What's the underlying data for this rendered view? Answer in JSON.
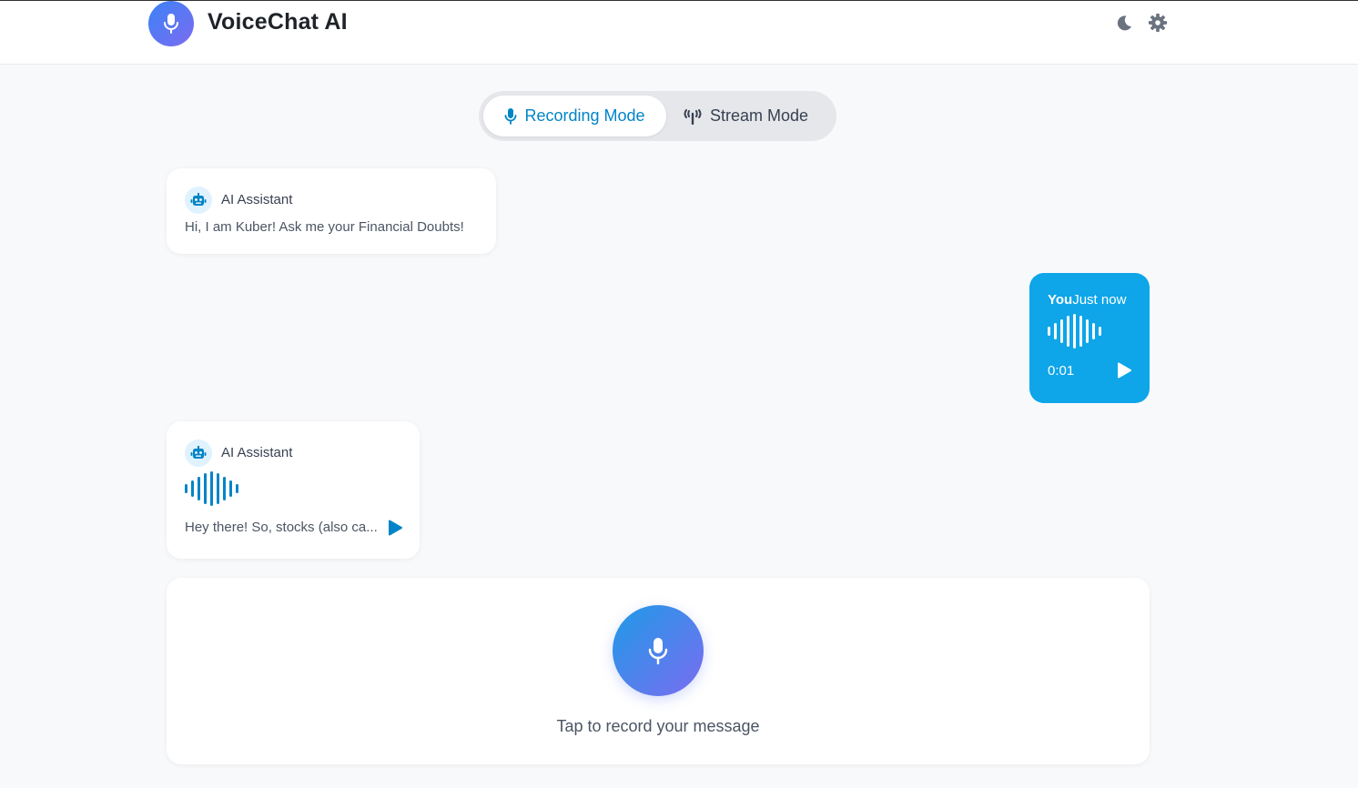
{
  "app": {
    "title": "VoiceChat AI"
  },
  "header": {
    "icons": [
      "moon-icon",
      "gear-icon"
    ]
  },
  "modes": {
    "recording_label": "Recording Mode",
    "stream_label": "Stream Mode",
    "active": "Recording Mode"
  },
  "messages": [
    {
      "sender": "AI Assistant",
      "text": "Hi, I am Kuber! Ask me your Financial Doubts!"
    },
    {
      "sender": "You",
      "time": "Just now",
      "duration": "0:01"
    },
    {
      "sender": "AI Assistant",
      "text": "Hey there! So, stocks (also ca..."
    }
  ],
  "composer": {
    "hint": "Tap to record your message"
  },
  "colors": {
    "accent": "#0284c7",
    "user_bubble": "#0ea5e9",
    "background": "#f8f9fb"
  }
}
